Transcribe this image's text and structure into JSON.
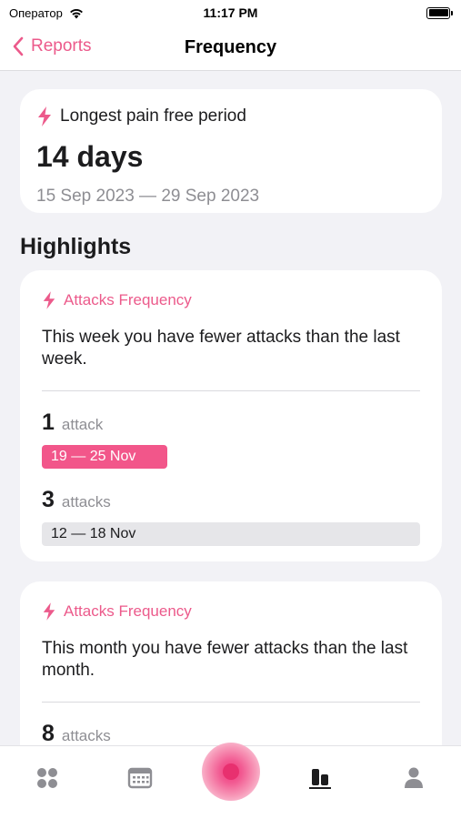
{
  "status_bar": {
    "carrier": "Оператор",
    "time": "11:17 PM"
  },
  "nav": {
    "back_label": "Reports",
    "title": "Frequency"
  },
  "pain_free": {
    "label": "Longest pain free period",
    "value": "14 days",
    "range": "15 Sep 2023 — 29 Sep 2023"
  },
  "section_title": "Highlights",
  "highlights": [
    {
      "title": "Attacks Frequency",
      "message": "This week you have fewer attacks than the last week.",
      "current": {
        "count": "1",
        "unit": "attack",
        "period": "19 — 25 Nov"
      },
      "previous": {
        "count": "3",
        "unit": "attacks",
        "period": "12 — 18 Nov"
      }
    },
    {
      "title": "Attacks Frequency",
      "message": "This month you have fewer attacks than the last month.",
      "current": {
        "count": "8",
        "unit": "attacks"
      }
    }
  ],
  "tab_bar": {
    "tabs": [
      "home-icon",
      "calendar-icon",
      "record-icon",
      "reports-icon",
      "profile-icon"
    ],
    "active": "reports-icon"
  },
  "colors": {
    "accent": "#ec5a8b",
    "current_bar": "#f2568a",
    "previous_bar": "#e6e6e9"
  }
}
